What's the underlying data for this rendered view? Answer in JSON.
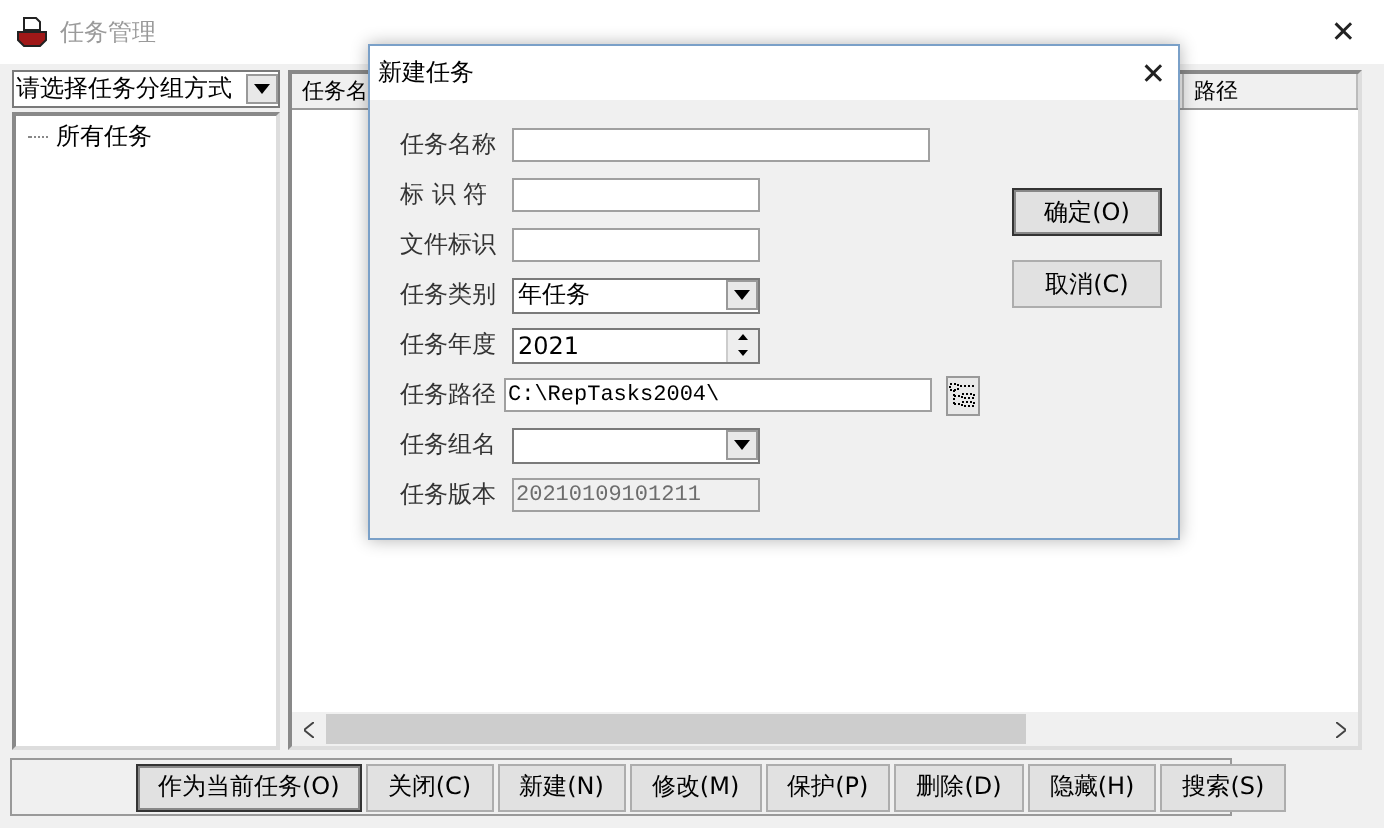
{
  "window": {
    "title": "任务管理",
    "close": "✕"
  },
  "group_select": {
    "value": "请选择任务分组方式"
  },
  "tree": [
    {
      "label": "所有任务",
      "selected": false
    }
  ],
  "list_columns": [
    "任务名",
    "路径"
  ],
  "buttons": [
    {
      "label": "作为当前任务(O)",
      "default": true
    },
    {
      "label": "关闭(C)",
      "default": false
    },
    {
      "label": "新建(N)",
      "default": false
    },
    {
      "label": "修改(M)",
      "default": false
    },
    {
      "label": "保护(P)",
      "default": false
    },
    {
      "label": "删除(D)",
      "default": false
    },
    {
      "label": "隐藏(H)",
      "default": false
    },
    {
      "label": "搜索(S)",
      "default": false
    }
  ],
  "dialog": {
    "title": "新建任务",
    "close": "✕",
    "fields": [
      {
        "label": "任务名称",
        "kind": "longtext",
        "disabled": false
      },
      {
        "label": "标 识 符",
        "kind": "shorttext",
        "disabled": false
      },
      {
        "label": "文件标识",
        "kind": "shorttext",
        "disabled": false
      },
      {
        "label": "任务类别",
        "kind": "combo",
        "value": "年任务",
        "disabled": false
      },
      {
        "label": "任务年度",
        "kind": "spin",
        "value": "2021",
        "disabled": false
      },
      {
        "label": "任务路径",
        "kind": "path",
        "value": "C:\\RepTasks2004\\",
        "disabled": false
      },
      {
        "label": "任务组名",
        "kind": "combo",
        "disabled": false
      },
      {
        "label": "任务版本",
        "kind": "shorttext",
        "value": "20210109101211",
        "disabled": true
      }
    ],
    "buttons": [
      {
        "label": "确定(O)",
        "default": true
      },
      {
        "label": "取消(C)",
        "default": false
      }
    ]
  }
}
